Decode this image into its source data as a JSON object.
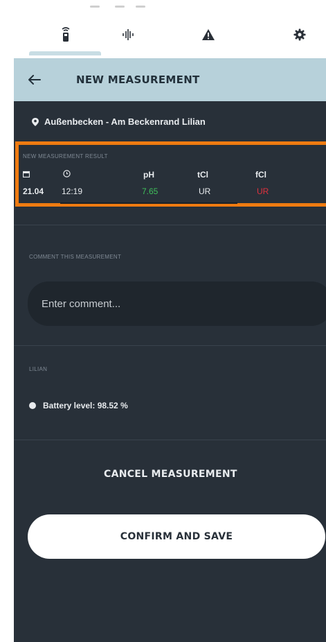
{
  "tabs": [
    {
      "id": "device",
      "icon": "handheld-device-icon",
      "active": true
    },
    {
      "id": "measure",
      "icon": "waveform-icon",
      "active": false
    },
    {
      "id": "alerts",
      "icon": "warning-icon",
      "active": false
    },
    {
      "id": "settings",
      "icon": "gear-icon",
      "active": false
    }
  ],
  "header": {
    "title": "NEW MEASUREMENT"
  },
  "location": {
    "name": "Außenbecken - Am Beckenrand Lilian"
  },
  "result": {
    "label": "NEW MEASUREMENT RESULT",
    "columns": {
      "date_icon": "calendar-icon",
      "time_icon": "clock-icon",
      "ph": "pH",
      "tcl": "tCl",
      "fcl": "fCl"
    },
    "values": {
      "date": "21.04",
      "time": "12:19",
      "ph": "7.65",
      "tcl": "UR",
      "fcl": "UR"
    },
    "colors": {
      "ph": "#3fbf5a",
      "fcl": "#e0303e"
    }
  },
  "comment": {
    "label": "COMMENT THIS MEASUREMENT",
    "placeholder": "Enter comment..."
  },
  "device": {
    "label": "LILIAN",
    "battery": "Battery level: 98.52 %"
  },
  "actions": {
    "cancel": "CANCEL MEASUREMENT",
    "confirm": "CONFIRM AND SAVE"
  },
  "colors": {
    "header_bg": "#b7d1da",
    "panel_bg": "#283039",
    "highlight": "#ef7b11"
  }
}
